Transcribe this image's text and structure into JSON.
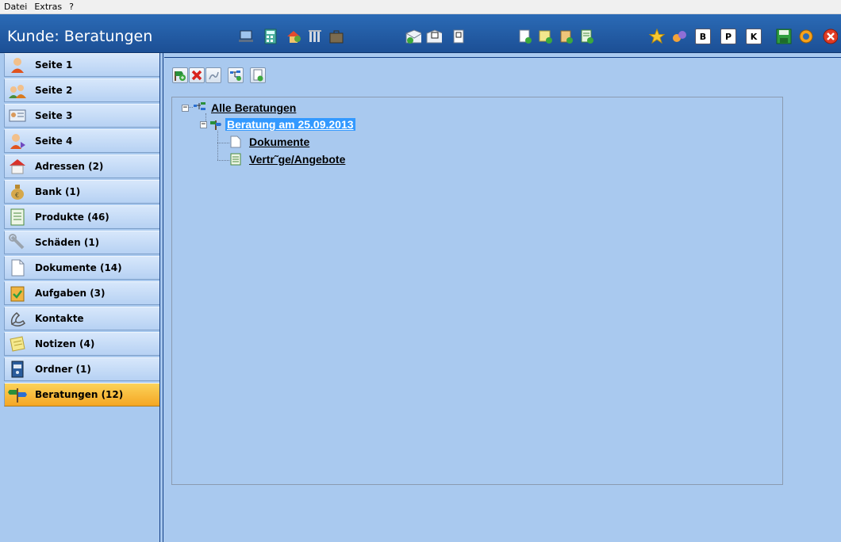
{
  "menu": {
    "items": [
      "Datei",
      "Extras",
      "?"
    ]
  },
  "window": {
    "title": "Kunde: Beratungen"
  },
  "sidebar": {
    "items": [
      {
        "label": "Seite 1"
      },
      {
        "label": "Seite 2"
      },
      {
        "label": "Seite 3"
      },
      {
        "label": "Seite 4"
      },
      {
        "label": "Adressen (2)"
      },
      {
        "label": "Bank (1)"
      },
      {
        "label": "Produkte (46)"
      },
      {
        "label": "Schäden (1)"
      },
      {
        "label": "Dokumente (14)"
      },
      {
        "label": "Aufgaben (3)"
      },
      {
        "label": "Kontakte"
      },
      {
        "label": "Notizen (4)"
      },
      {
        "label": "Ordner (1)"
      },
      {
        "label": "Beratungen (12)",
        "active": true
      }
    ]
  },
  "toolbar": {
    "letters": [
      "B",
      "P",
      "K"
    ]
  },
  "tree": {
    "root": "Alle Beratungen",
    "child": "Beratung am 25.09.2013",
    "leaves": [
      "Dokumente",
      "Vertr˜ge/Angebote"
    ]
  },
  "colors": {
    "background": "#a9c9ef",
    "titlebar": "#1f5aa3",
    "active_nav": "#f5a623",
    "selection": "#3399ff"
  }
}
